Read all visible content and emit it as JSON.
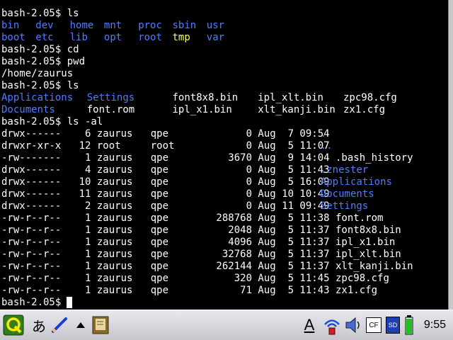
{
  "terminal": {
    "lines": [
      [
        {
          "text": "bash-2.05$ ls",
          "color": "white",
          "col": 0
        }
      ],
      [
        {
          "text": "bin",
          "color": "blue",
          "col": 0
        },
        {
          "text": "dev",
          "color": "blue",
          "col": 6
        },
        {
          "text": "home",
          "color": "blue",
          "col": 12
        },
        {
          "text": "mnt",
          "color": "blue",
          "col": 18
        },
        {
          "text": "proc",
          "color": "blue",
          "col": 24
        },
        {
          "text": "sbin",
          "color": "blue",
          "col": 30
        },
        {
          "text": "usr",
          "color": "blue",
          "col": 36
        }
      ],
      [
        {
          "text": "boot",
          "color": "blue",
          "col": 0
        },
        {
          "text": "etc",
          "color": "blue",
          "col": 6
        },
        {
          "text": "lib",
          "color": "blue",
          "col": 12
        },
        {
          "text": "opt",
          "color": "blue",
          "col": 18
        },
        {
          "text": "root",
          "color": "blue",
          "col": 24
        },
        {
          "text": "tmp",
          "color": "yellow",
          "col": 30
        },
        {
          "text": "var",
          "color": "blue",
          "col": 36
        }
      ],
      [
        {
          "text": "bash-2.05$ cd",
          "color": "white",
          "col": 0
        }
      ],
      [
        {
          "text": "bash-2.05$ pwd",
          "color": "white",
          "col": 0
        }
      ],
      [
        {
          "text": "/home/zaurus",
          "color": "white",
          "col": 0
        }
      ],
      [
        {
          "text": "bash-2.05$ ls",
          "color": "white",
          "col": 0
        }
      ],
      [
        {
          "text": "Applications",
          "color": "blue",
          "col": 0
        },
        {
          "text": "Settings",
          "color": "blue",
          "col": 15
        },
        {
          "text": "font8x8.bin",
          "color": "white",
          "col": 30
        },
        {
          "text": "ipl_xlt.bin",
          "color": "white",
          "col": 45
        },
        {
          "text": "zpc98.cfg",
          "color": "white",
          "col": 60
        }
      ],
      [
        {
          "text": "Documents",
          "color": "blue",
          "col": 0
        },
        {
          "text": "font.rom",
          "color": "white",
          "col": 15
        },
        {
          "text": "ipl_x1.bin",
          "color": "white",
          "col": 30
        },
        {
          "text": "xlt_kanji.bin",
          "color": "white",
          "col": 45
        },
        {
          "text": "zx1.cfg",
          "color": "white",
          "col": 60
        }
      ],
      [
        {
          "text": "bash-2.05$ ls -al",
          "color": "white",
          "col": 0
        }
      ],
      [
        {
          "text": "drwx------    6 zaurus   qpe             0 Aug  7 09:54 ",
          "color": "white",
          "col": 0
        },
        {
          "text": ".",
          "color": "blue",
          "col": 56
        }
      ],
      [
        {
          "text": "drwxr-xr-x   12 root     root            0 Aug  5 11:07 ",
          "color": "white",
          "col": 0
        },
        {
          "text": "..",
          "color": "blue",
          "col": 56
        }
      ],
      [
        {
          "text": "-rw-------    1 zaurus   qpe          3670 Aug  9 14:04 .bash_history",
          "color": "white",
          "col": 0
        }
      ],
      [
        {
          "text": "drwx------    4 zaurus   qpe             0 Aug  5 11:43 ",
          "color": "white",
          "col": 0
        },
        {
          "text": ".znester",
          "color": "blue",
          "col": 56
        }
      ],
      [
        {
          "text": "drwx------   10 zaurus   qpe             0 Aug  5 16:09 ",
          "color": "white",
          "col": 0
        },
        {
          "text": "Applications",
          "color": "blue",
          "col": 56
        }
      ],
      [
        {
          "text": "drwx------   11 zaurus   qpe             0 Aug 10 10:49 ",
          "color": "white",
          "col": 0
        },
        {
          "text": "Documents",
          "color": "blue",
          "col": 56
        }
      ],
      [
        {
          "text": "drwx------    2 zaurus   qpe             0 Aug 11 09:49 ",
          "color": "white",
          "col": 0
        },
        {
          "text": "Settings",
          "color": "blue",
          "col": 56
        }
      ],
      [
        {
          "text": "-rw-r--r--    1 zaurus   qpe        288768 Aug  5 11:38 font.rom",
          "color": "white",
          "col": 0
        }
      ],
      [
        {
          "text": "-rw-r--r--    1 zaurus   qpe          2048 Aug  5 11:37 font8x8.bin",
          "color": "white",
          "col": 0
        }
      ],
      [
        {
          "text": "-rw-r--r--    1 zaurus   qpe          4096 Aug  5 11:37 ipl_x1.bin",
          "color": "white",
          "col": 0
        }
      ],
      [
        {
          "text": "-rw-r--r--    1 zaurus   qpe         32768 Aug  5 11:37 ipl_xlt.bin",
          "color": "white",
          "col": 0
        }
      ],
      [
        {
          "text": "-rw-r--r--    1 zaurus   qpe        262144 Aug  5 11:37 xlt_kanji.bin",
          "color": "white",
          "col": 0
        }
      ],
      [
        {
          "text": "-rw-r--r--    1 zaurus   qpe           320 Aug  5 11:45 zpc98.cfg",
          "color": "white",
          "col": 0
        }
      ],
      [
        {
          "text": "-rw-r--r--    1 zaurus   qpe            71 Aug  5 11:43 zx1.cfg",
          "color": "white",
          "col": 0
        }
      ],
      [
        {
          "text": "bash-2.05$ ",
          "color": "white",
          "col": 0
        }
      ]
    ]
  },
  "colors": {
    "white": "#ffffff",
    "blue": "#4f7cff",
    "yellow": "#ffff55",
    "terminal_bg": "#000000"
  },
  "taskbar": {
    "start_icon": "q-start-icon",
    "input_method_label": "あ",
    "pen_icon": "pen-icon",
    "up_arrow_icon": "up-arrow-icon",
    "terminal_app_icon": "terminal-app-icon",
    "keyboard_a_label": "A",
    "wifi_icon": "wifi-icon",
    "volume_icon": "volume-icon",
    "cf_card_label": "CF",
    "sd_card_label": "SD",
    "battery_icon": "battery-icon",
    "clock": "9:55"
  }
}
